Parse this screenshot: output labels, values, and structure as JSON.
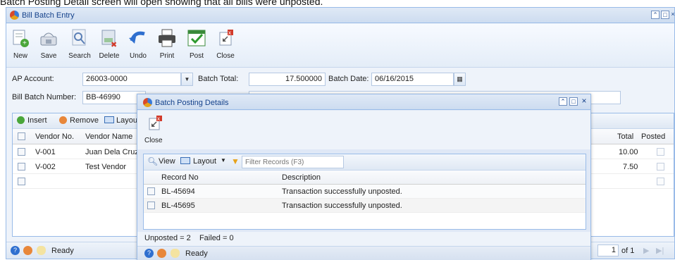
{
  "caption": "Batch Posting Detail screen will open showing that all bills were unposted.",
  "window": {
    "title": "Bill Batch Entry",
    "toolbar": [
      {
        "label": "New",
        "icon": "new-icon"
      },
      {
        "label": "Save",
        "icon": "save-icon"
      },
      {
        "label": "Search",
        "icon": "search-icon"
      },
      {
        "label": "Delete",
        "icon": "delete-icon"
      },
      {
        "label": "Undo",
        "icon": "undo-icon"
      },
      {
        "label": "Print",
        "icon": "print-icon"
      },
      {
        "label": "Post",
        "icon": "post-icon"
      },
      {
        "label": "Close",
        "icon": "close-icon"
      }
    ],
    "form": {
      "ap_account_label": "AP Account:",
      "ap_account_value": "26003-0000",
      "batch_total_label": "Batch Total:",
      "batch_total_value": "17.500000",
      "batch_date_label": "Batch Date:",
      "batch_date_value": "06/16/2015",
      "bill_batch_number_label": "Bill Batch Number:",
      "bill_batch_number_value": "BB-46990"
    },
    "grid": {
      "insert_label": "Insert",
      "remove_label": "Remove",
      "layout_label": "Layout",
      "columns": {
        "vendor_no": "Vendor No.",
        "vendor_name": "Vendor Name",
        "total": "Total",
        "posted": "Posted"
      },
      "rows": [
        {
          "vendor_no": "V-001",
          "vendor_name": "Juan Dela Cruz",
          "total": "10.00"
        },
        {
          "vendor_no": "V-002",
          "vendor_name": "Test Vendor",
          "total": "7.50"
        }
      ]
    },
    "status": {
      "text": "Ready",
      "page_value": "1",
      "page_of": "of 1"
    }
  },
  "dialog": {
    "title": "Batch Posting Details",
    "close_label": "Close",
    "view_label": "View",
    "layout_label": "Layout",
    "filter_placeholder": "Filter Records (F3)",
    "columns": {
      "record_no": "Record No",
      "description": "Description"
    },
    "rows": [
      {
        "record_no": "BL-45694",
        "description": "Transaction successfully unposted."
      },
      {
        "record_no": "BL-45695",
        "description": "Transaction successfully unposted."
      }
    ],
    "footer": "Unposted = 2    Failed = 0",
    "status_text": "Ready"
  }
}
